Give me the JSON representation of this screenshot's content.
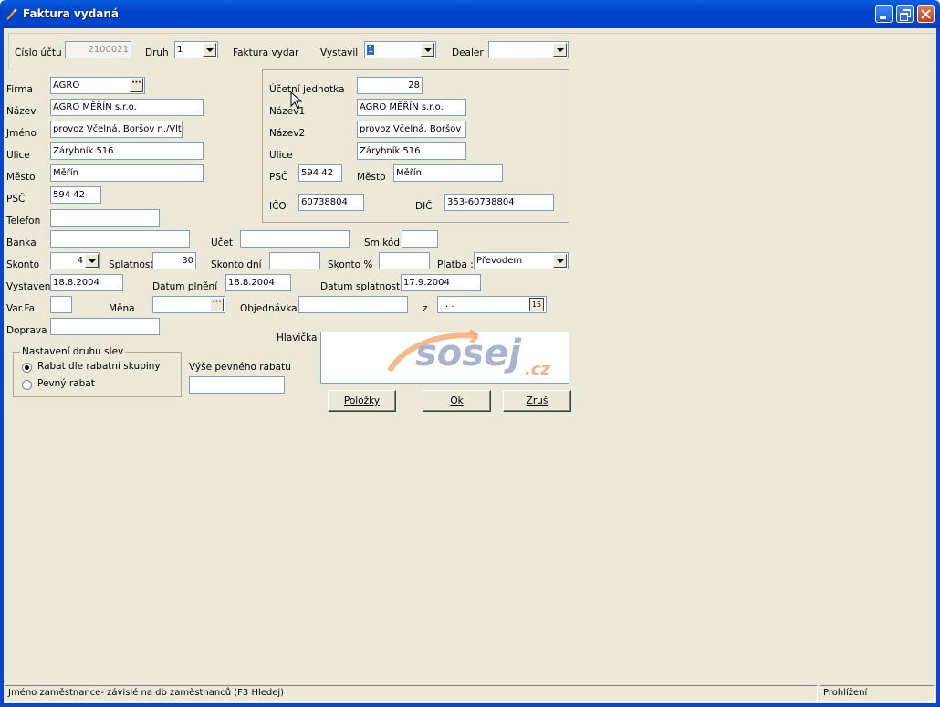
{
  "window": {
    "title": "Faktura vydaná"
  },
  "header": {
    "cislo_uctu_label": "Číslo účtu",
    "cislo_uctu_value": "2100021",
    "druh_label": "Druh",
    "druh_value": "1",
    "faktura_label": "Faktura vydar",
    "vystavil_label": "Vystavil",
    "vystavil_value": "1",
    "dealer_label": "Dealer",
    "dealer_value": ""
  },
  "left": {
    "firma_label": "Firma",
    "firma_value": "AGRO",
    "nazev_label": "Název",
    "nazev_value": "AGRO MĚŘÍN s.r.o.",
    "jmeno_label": "Jméno",
    "jmeno_value": "provoz Včelná, Boršov n./Vlt.",
    "ulice_label": "Ulice",
    "ulice_value": "Zárybník 516",
    "mesto_label": "Město",
    "mesto_value": "Měřín",
    "psc_label": "PSČ",
    "psc_value": "594 42",
    "telefon_label": "Telefon",
    "telefon_value": ""
  },
  "unit": {
    "ucetni_label": "Účetní jednotka",
    "ucetni_value": "28",
    "nazev1_label": "Název1",
    "nazev1_value": "AGRO MĚŘÍN s.r.o.",
    "nazev2_label": "Název2",
    "nazev2_value": "provoz Včelná, Boršov",
    "ulice_label": "Ulice",
    "ulice_value": "Zárybník 516",
    "psc_label": "PSČ",
    "psc_value": "594 42",
    "mesto_label": "Město",
    "mesto_value": "Měřín",
    "ico_label": "IČO",
    "ico_value": "60738804",
    "dic_label": "DIČ",
    "dic_value": "353-60738804"
  },
  "payment": {
    "banka_label": "Banka",
    "banka_value": "",
    "ucet_label": "Účet",
    "ucet_value": "",
    "smkod_label": "Sm.kód",
    "smkod_value": "",
    "skonto_label": "Skonto",
    "skonto_value": "4",
    "splatnost_label": "Splatnost",
    "splatnost_value": "30",
    "skonto_dni_label": "Skonto dní",
    "skonto_dni_value": "",
    "skonto_pct_label": "Skonto %",
    "skonto_pct_value": "",
    "platba_label": "Platba :",
    "platba_value": "Převodem",
    "vystaveni_label": "Vystavení",
    "vystaveni_value": "18.8.2004",
    "plneni_label": "Datum plnění",
    "plneni_value": "18.8.2004",
    "splatnosti_label": "Datum splatnosti",
    "splatnosti_value": "17.9.2004",
    "varfa_label": "Var.Fa",
    "varfa_value": "",
    "mena_label": "Měna",
    "mena_value": "",
    "objednavka_label": "Objednávka",
    "objednavka_value": "",
    "z_label": "z",
    "z_value": ". .",
    "doprava_label": "Doprava",
    "doprava_value": ""
  },
  "discount": {
    "legend": "Nastavení druhu slev",
    "option1": "Rabat dle rabatní skupiny",
    "option2": "Pevný rabat",
    "fixed_label": "Výše pevného rabatu",
    "fixed_value": ""
  },
  "header_note": {
    "label": "Hlavička",
    "logo_text": "sosej",
    "logo_suffix": ".cz"
  },
  "buttons": {
    "items": "Položky",
    "ok": "Ok",
    "cancel": "Zruš"
  },
  "status": {
    "left": "Jméno zaměstnance- závislé na db zaměstnanců (F3 Hledej)",
    "right": "Prohlížení"
  },
  "colors": {
    "titlebar": "#0054e3",
    "window": "#ece9d8",
    "logo_orange": "#f2a96a",
    "logo_blue": "#9aa7c7"
  }
}
